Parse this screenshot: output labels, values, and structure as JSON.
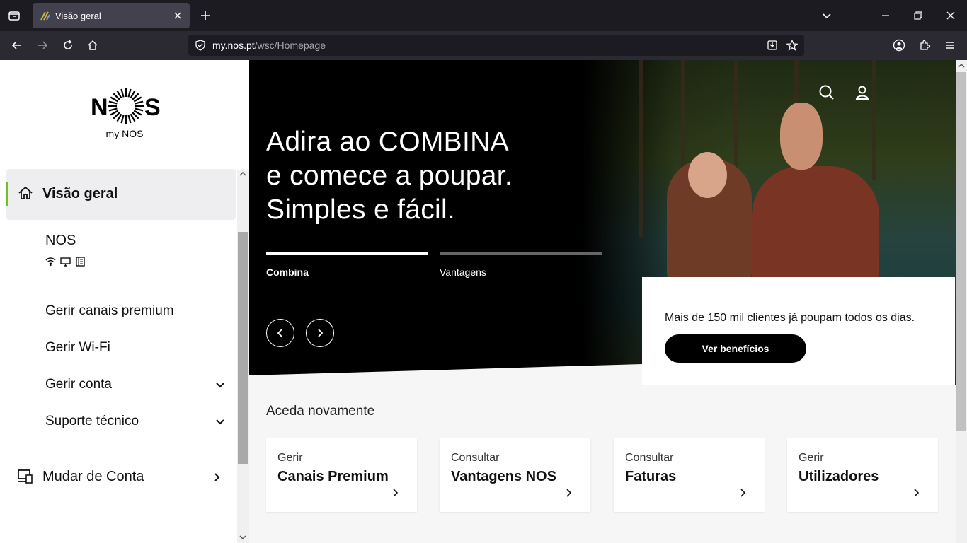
{
  "browser": {
    "tab_title": "Visão geral",
    "url_host": "my.nos.pt",
    "url_path": "/wsc/Homepage"
  },
  "sidebar": {
    "logo_text": "NOS",
    "logo_sub": "my NOS",
    "active_item": "Visão geral",
    "service_name": "NOS",
    "items": [
      {
        "label": "Gerir canais premium",
        "has_chevron": false
      },
      {
        "label": "Gerir Wi-Fi",
        "has_chevron": false
      },
      {
        "label": "Gerir conta",
        "has_chevron": true
      },
      {
        "label": "Suporte técnico",
        "has_chevron": true
      }
    ],
    "switch_account": "Mudar de Conta"
  },
  "hero": {
    "headline": [
      "Adira ao COMBINA",
      "e comece a poupar.",
      "Simples e fácil."
    ],
    "tabs": [
      "Combina",
      "Vantagens"
    ],
    "promo_text": "Mais de 150 mil clientes já poupam todos os dias.",
    "promo_button": "Ver benefícios"
  },
  "recent": {
    "title": "Aceda novamente",
    "cards": [
      {
        "action": "Gerir",
        "title": "Canais Premium"
      },
      {
        "action": "Consultar",
        "title": "Vantagens NOS"
      },
      {
        "action": "Consultar",
        "title": "Faturas"
      },
      {
        "action": "Gerir",
        "title": "Utilizadores"
      }
    ]
  },
  "colors": {
    "accent": "#78be20",
    "hero_bg": "#000000"
  }
}
